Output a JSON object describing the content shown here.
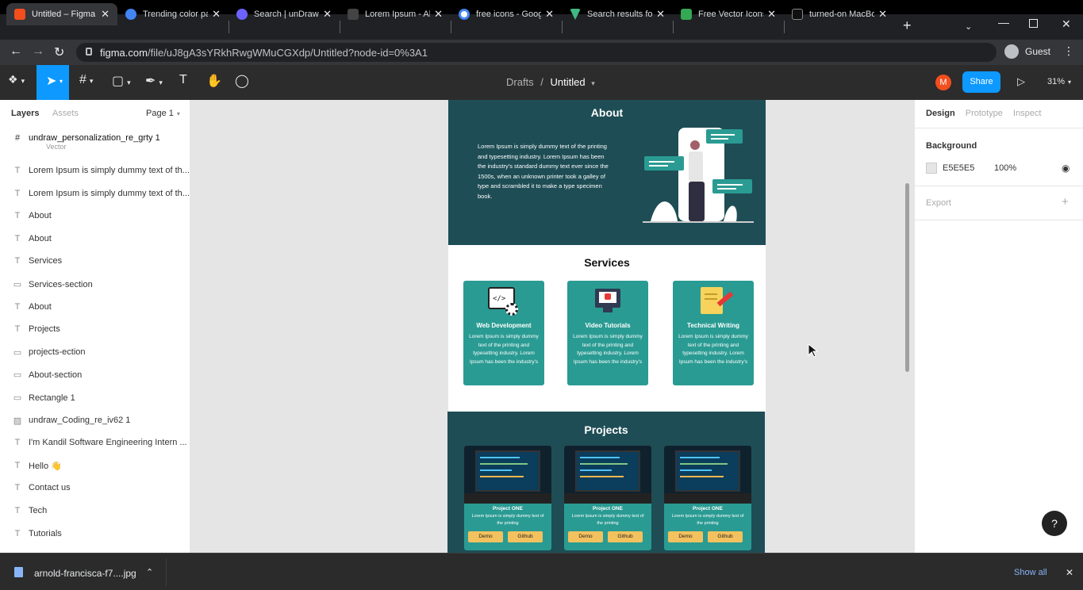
{
  "browser": {
    "tabs": [
      {
        "title": "Untitled – Figma",
        "active": true,
        "icon": "figma-icon",
        "color": "#f24e1e"
      },
      {
        "title": "Trending color pa",
        "icon": "coolors-icon",
        "color": "#4285f4"
      },
      {
        "title": "Search | unDraw",
        "icon": "undraw-icon",
        "color": "#6c63ff"
      },
      {
        "title": "Lorem Ipsum - All",
        "icon": "lipsum-icon",
        "color": "#444444"
      },
      {
        "title": "free icons - Goog",
        "icon": "google-icon",
        "color": "#ffffff"
      },
      {
        "title": "Search results for",
        "icon": "vue-icon",
        "color": "#41b883"
      },
      {
        "title": "Free Vector Icons",
        "icon": "flaticon-icon",
        "color": "#34a853"
      },
      {
        "title": "turned-on MacBo",
        "icon": "unsplash-icon",
        "color": "#111111"
      }
    ],
    "url_host": "figma.com",
    "url_path": "/file/uJ8gA3sYRkhRwgWMuCGXdp/Untitled?node-id=0%3A1",
    "profile": "Guest"
  },
  "figma": {
    "breadcrumb_parent": "Drafts",
    "breadcrumb_sep": "/",
    "file_name": "Untitled",
    "avatar_letter": "M",
    "share_label": "Share",
    "zoom": "31%"
  },
  "layers_panel": {
    "tab_layers": "Layers",
    "tab_assets": "Assets",
    "page": "Page 1",
    "frame": "undraw_personalization_re_grty 1",
    "partial": "Vector",
    "items": [
      {
        "icon": "T",
        "name": "Lorem Ipsum is simply dummy text of th..."
      },
      {
        "icon": "T",
        "name": "Lorem Ipsum is simply dummy text of th..."
      },
      {
        "icon": "T",
        "name": "About"
      },
      {
        "icon": "T",
        "name": "About"
      },
      {
        "icon": "T",
        "name": "Services"
      },
      {
        "icon": "▭",
        "name": "Services-section"
      },
      {
        "icon": "T",
        "name": "About"
      },
      {
        "icon": "T",
        "name": "Projects"
      },
      {
        "icon": "▭",
        "name": "projects-ection"
      },
      {
        "icon": "▭",
        "name": "About-section"
      },
      {
        "icon": "▭",
        "name": "Rectangle 1"
      },
      {
        "icon": "▨",
        "name": "undraw_Coding_re_iv62 1"
      },
      {
        "icon": "T",
        "name": "I'm Kandil Software Engineering Intern ..."
      },
      {
        "icon": "T",
        "name": "Hello 👋"
      },
      {
        "icon": "T",
        "name": "Contact us"
      },
      {
        "icon": "T",
        "name": "Tech"
      },
      {
        "icon": "T",
        "name": "Tutorials"
      }
    ]
  },
  "design_panel": {
    "tabs": [
      "Design",
      "Prototype",
      "Inspect"
    ],
    "background_label": "Background",
    "bg_hex": "E5E5E5",
    "bg_opacity": "100%",
    "export_label": "Export",
    "help": "?"
  },
  "canvas": {
    "about": {
      "title": "About",
      "text": "Lorem Ipsum is simply dummy text of the printing and typesetting industry. Lorem Ipsum has been the industry's standard dummy text ever since the 1500s, when an unknown printer took a galley of type and scrambled it to make a type specimen book."
    },
    "services": {
      "title": "Services",
      "cards": [
        {
          "title": "Web Development",
          "text": "Lorem Ipsum is simply dummy text of the printing and typesetting industry. Lorem Ipsum has been the industry's"
        },
        {
          "title": "Video Tutorials",
          "text": "Lorem Ipsum is simply dummy text of the printing and typesetting industry. Lorem Ipsum has been the industry's"
        },
        {
          "title": "Technical Writing",
          "text": "Lorem Ipsum is simply dummy text of the printing and typesetting industry. Lorem Ipsum has been the industry's"
        }
      ]
    },
    "projects": {
      "title": "Projects",
      "cards": [
        {
          "title": "Project ONE",
          "text": "Lorem Ipsum is simply dummy text of the printing",
          "demo": "Demo",
          "github": "Github"
        },
        {
          "title": "Project ONE",
          "text": "Lorem Ipsum is simply dummy text of the printing",
          "demo": "Demo",
          "github": "Github"
        },
        {
          "title": "Project ONE",
          "text": "Lorem Ipsum is simply dummy text of the printing",
          "demo": "Demo",
          "github": "Github"
        }
      ]
    }
  },
  "download_bar": {
    "file": "arnold-francisca-f7....jpg",
    "show_all": "Show all"
  },
  "colors": {
    "accent": "#0d99ff",
    "section_dark": "#1e4d55",
    "card_teal": "#2a9b93",
    "button_yellow": "#f3c15e"
  }
}
